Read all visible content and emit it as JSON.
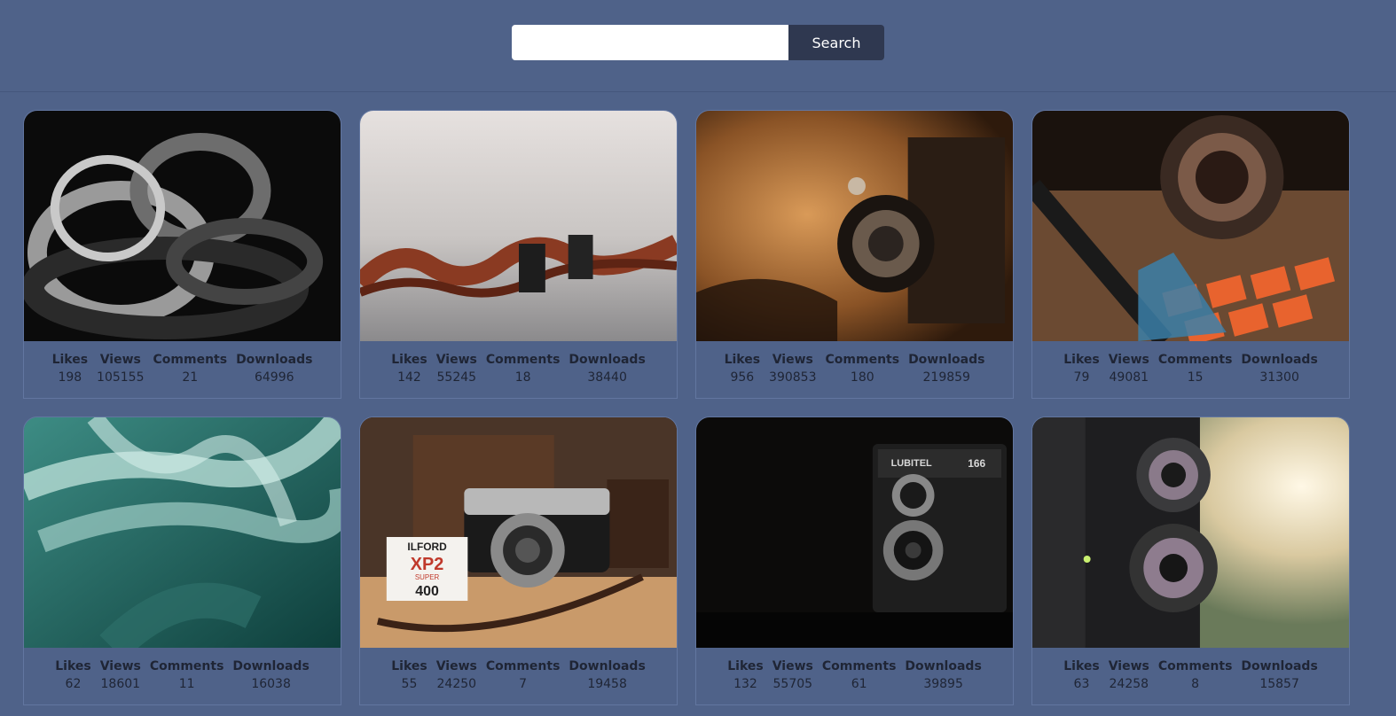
{
  "search": {
    "placeholder": "",
    "value": "",
    "button_label": "Search"
  },
  "stat_labels": {
    "likes": "Likes",
    "views": "Views",
    "comments": "Comments",
    "downloads": "Downloads"
  },
  "cards": [
    {
      "image": "film-strip-curls-dark",
      "likes": "198",
      "views": "105155",
      "comments": "21",
      "downloads": "64996"
    },
    {
      "image": "film-strip-on-table",
      "likes": "142",
      "views": "55245",
      "comments": "18",
      "downloads": "38440"
    },
    {
      "image": "vintage-folding-camera-sepia",
      "likes": "956",
      "views": "390853",
      "comments": "180",
      "downloads": "219859"
    },
    {
      "image": "vintage-lens-with-stamps",
      "likes": "79",
      "views": "49081",
      "comments": "15",
      "downloads": "31300"
    },
    {
      "image": "film-strip-teal",
      "likes": "62",
      "views": "18601",
      "comments": "11",
      "downloads": "16038"
    },
    {
      "image": "rangefinder-camera-ilford-film",
      "likes": "55",
      "views": "24250",
      "comments": "7",
      "downloads": "19458"
    },
    {
      "image": "lubitel-166-camera",
      "likes": "132",
      "views": "55705",
      "comments": "61",
      "downloads": "39895"
    },
    {
      "image": "twin-lens-reflex-camera",
      "likes": "63",
      "views": "24258",
      "comments": "8",
      "downloads": "15857"
    }
  ],
  "photo_text": {
    "ilford_brand": "ILFORD",
    "ilford_product": "XP2",
    "ilford_line": "SUPER",
    "ilford_iso": "400",
    "lubitel_brand": "LUBITEL",
    "lubitel_model": "166"
  }
}
